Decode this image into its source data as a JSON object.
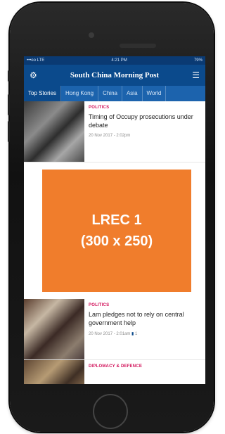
{
  "status_bar": {
    "carrier": "•••oo LTE",
    "time": "4:21 PM",
    "battery": "79%"
  },
  "header": {
    "title": "South China Morning Post"
  },
  "tabs": [
    {
      "label": "Top Stories",
      "active": true
    },
    {
      "label": "Hong Kong",
      "active": false
    },
    {
      "label": "China",
      "active": false
    },
    {
      "label": "Asia",
      "active": false
    },
    {
      "label": "World",
      "active": false
    }
  ],
  "articles": [
    {
      "category": "POLITICS",
      "headline": "Timing of Occupy prosecutions under debate",
      "date": "20 Nov 2017 - 2:02pm"
    },
    {
      "category": "POLITICS",
      "headline": "Lam pledges not to rely on central government help",
      "date": "20 Nov 2017 - 2:01am",
      "comments": "1"
    },
    {
      "category": "DIPLOMACY & DEFENCE"
    }
  ],
  "ad": {
    "line1": "LREC 1",
    "line2": "(300 x 250)"
  },
  "colors": {
    "nav": "#0b4a8c",
    "tabs": "#1c63ad",
    "label": "#d2125a",
    "ad": "#f07d2c"
  }
}
